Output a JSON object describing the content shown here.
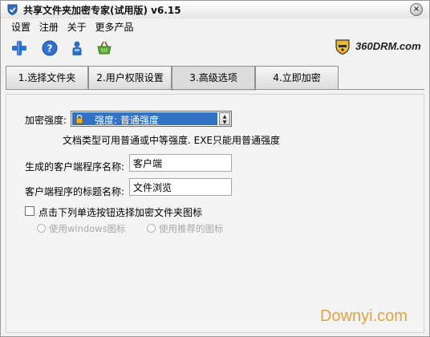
{
  "window": {
    "title": "共享文件夹加密专家(试用版) v6.15",
    "close_symbol": "×"
  },
  "menu": [
    "设置",
    "注册",
    "关于",
    "更多产品"
  ],
  "toolbar": {
    "icons": [
      "plus-icon",
      "help-icon",
      "user-icon",
      "basket-icon"
    ]
  },
  "brand": {
    "text": "360DRM.com"
  },
  "tabs": [
    {
      "label": "1.选择文件夹",
      "active": false
    },
    {
      "label": "2.用户权限设置",
      "active": false
    },
    {
      "label": "3.高级选项",
      "active": true
    },
    {
      "label": "4.立即加密",
      "active": false
    }
  ],
  "advanced": {
    "strength_label": "加密强度:",
    "strength_value": "强度: 普通强度",
    "strength_note": "文档类型可用普通或中等强度. EXE只能用普通强度",
    "client_name_label": "生成的客户端程序名称:",
    "client_name_value": "客户端",
    "client_title_label": "客户端程序的标题名称:",
    "client_title_value": "文件浏览",
    "icon_checkbox_label": "点击下列单选按钮选择加密文件夹图标",
    "icon_checkbox_checked": false,
    "radio_windows_label": "使用windows图标",
    "radio_recommended_label": "使用推荐的图标"
  },
  "watermark": "Downyi.com",
  "colors": {
    "selection_blue": "#3272c4",
    "watermark_orange": "#e1a23c",
    "plus_blue": "#2d6fd1"
  }
}
